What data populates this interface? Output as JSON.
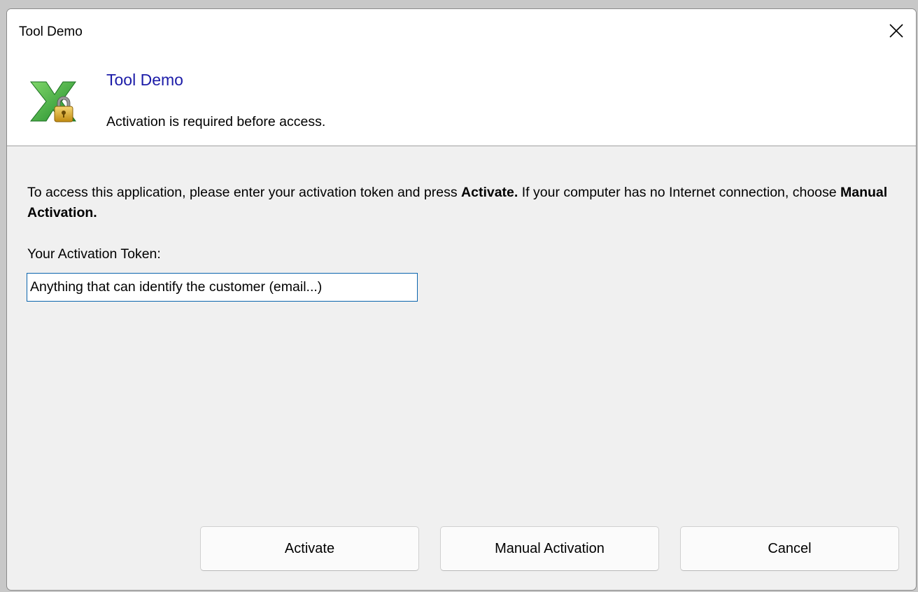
{
  "window": {
    "title": "Tool Demo",
    "close_glyph": "✕"
  },
  "header": {
    "icon": "excel-lock-icon",
    "title": "Tool Demo",
    "subtitle": "Activation is required before access."
  },
  "body": {
    "description": {
      "part1": "To access this application, please enter your activation token and press ",
      "bold1": "Activate.",
      "part2": " If your computer has no Internet connection, choose ",
      "bold2": "Manual Activation."
    },
    "token_label": "Your Activation Token:",
    "token_value": "Anything that can identify the customer (email...)"
  },
  "buttons": {
    "activate": "Activate",
    "manual": "Manual Activation",
    "cancel": "Cancel"
  },
  "colors": {
    "header_title": "#1c1ca8",
    "input_border": "#0a64ad",
    "icon_green": "#3aa935",
    "lock_gold": "#d9a81c"
  }
}
